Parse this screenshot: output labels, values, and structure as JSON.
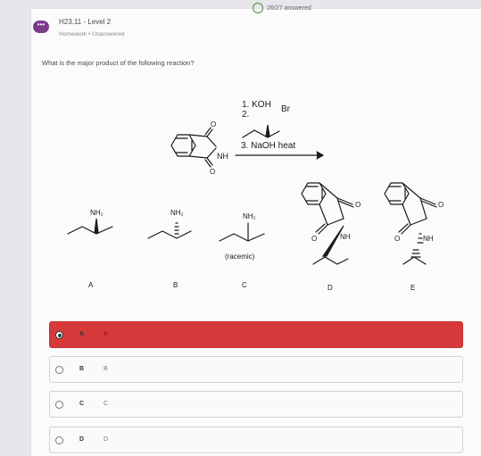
{
  "header": {
    "answered_status": "26/27 answered",
    "avatar_label": "•••",
    "title": "H23.11 - Level 2",
    "subtitle": "Homework  •  Unanswered"
  },
  "question": {
    "text": "What is the major product of the following reaction?",
    "reagents": {
      "step1": "1. KOH",
      "step2": "2.",
      "step2_reagent": "Br",
      "step3": "3. NaOH heat"
    },
    "start_material_label": "NH"
  },
  "structures": {
    "A": {
      "group": "NH₂",
      "label": "A"
    },
    "B": {
      "group": "NH₂",
      "label": "B"
    },
    "C": {
      "group": "NH₂",
      "note": "(racemic)",
      "label": "C"
    },
    "D": {
      "group": "NH",
      "label": "D"
    },
    "E": {
      "group": "NH",
      "label": "E"
    }
  },
  "choices": [
    {
      "letter": "A",
      "text": "A",
      "selected": true
    },
    {
      "letter": "B",
      "text": "B",
      "selected": false
    },
    {
      "letter": "C",
      "text": "C",
      "selected": false
    },
    {
      "letter": "D",
      "text": "D",
      "selected": false
    }
  ],
  "colors": {
    "selected": "#d63a3a",
    "avatar": "#7b3a8a",
    "status_ring": "#4a8f3c"
  }
}
